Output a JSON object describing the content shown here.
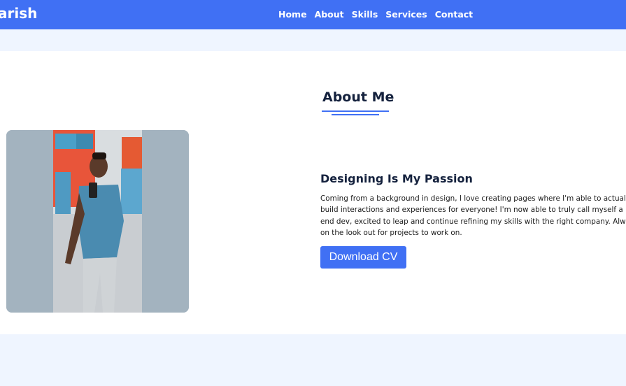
{
  "navbar": {
    "logo": "arish",
    "links": [
      "Home",
      "About",
      "Skills",
      "Services",
      "Contact"
    ]
  },
  "about": {
    "title": "About Me",
    "subtitle": "Designing Is My Passion",
    "description": "Coming from a background in design, I love creating pages where I'm able to actually build interactions and experiences for everyone! I'm now able to truly call myself a Front-end dev, excited to leap and continue refining my skills with the right company. Always on the look out for projects to work on.",
    "button_label": "Download CV"
  },
  "colors": {
    "brand": "#4070f4",
    "page_background": "#eff5ff",
    "heading": "#14213d"
  }
}
